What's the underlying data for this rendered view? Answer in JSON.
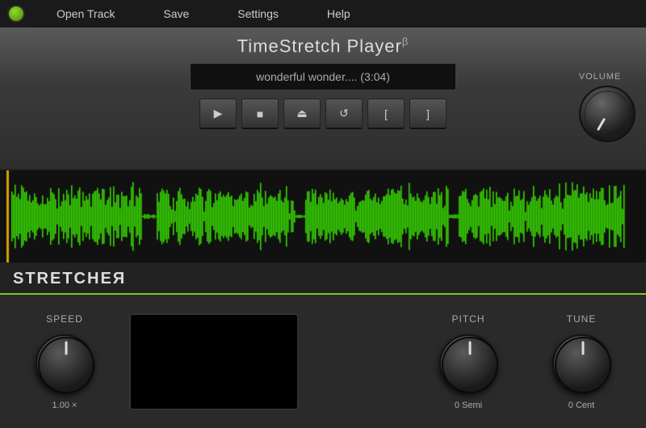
{
  "app": {
    "logo_alt": "TimeStretch logo",
    "title": "TimeStretch Player",
    "title_superscript": "β"
  },
  "menu": {
    "items": [
      {
        "id": "open-track",
        "label": "Open Track"
      },
      {
        "id": "save",
        "label": "Save"
      },
      {
        "id": "settings",
        "label": "Settings"
      },
      {
        "id": "help",
        "label": "Help"
      }
    ]
  },
  "player": {
    "track_name": "wonderful wonder....  (3:04)",
    "controls": [
      {
        "id": "play",
        "symbol": "▶",
        "label": "Play"
      },
      {
        "id": "stop",
        "symbol": "■",
        "label": "Stop"
      },
      {
        "id": "eject",
        "symbol": "⏏",
        "label": "Eject"
      },
      {
        "id": "loop",
        "symbol": "↺",
        "label": "Loop"
      },
      {
        "id": "mark-in",
        "symbol": "[",
        "label": "Mark In"
      },
      {
        "id": "mark-out",
        "symbol": "]",
        "label": "Mark Out"
      }
    ]
  },
  "volume": {
    "label": "VOLUME",
    "value": "0 dB",
    "rotation_deg": 270
  },
  "stretcher": {
    "title": "STRETCHEЯ",
    "speed": {
      "label": "SPEED",
      "value": "1.00 ×"
    },
    "pitch": {
      "label": "PITCH",
      "value": "0 Semi"
    },
    "tune": {
      "label": "TUNE",
      "value": "0 Cent"
    }
  },
  "waveform": {
    "color": "#39e000"
  }
}
